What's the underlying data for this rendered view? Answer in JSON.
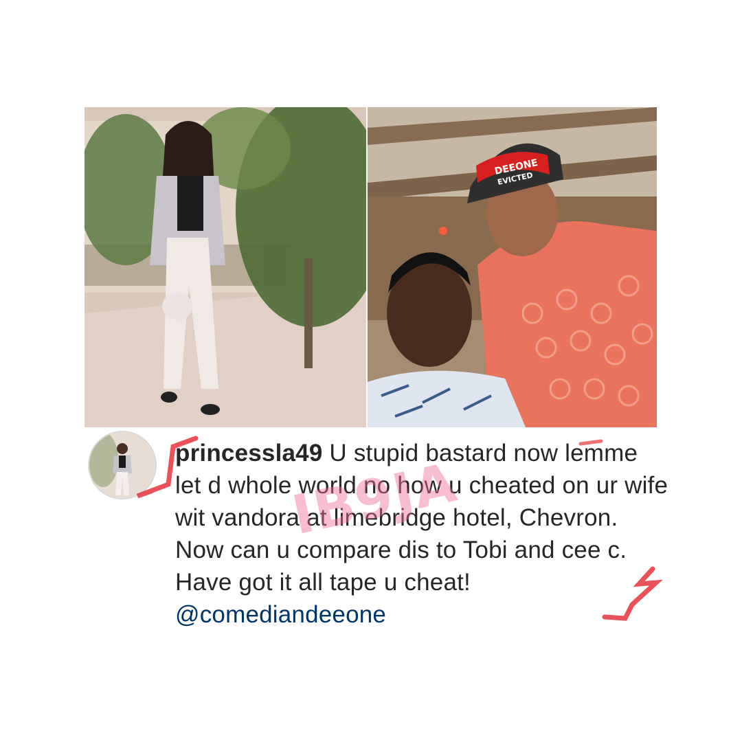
{
  "post": {
    "username": "princessla49",
    "comment": " U stupid bastard now lemme let d whole world no how u cheated on ur wife wit vandora at limebridge hotel, Chevron. Now can u compare dis to Tobi and cee c. Have got it all tape u cheat! ",
    "mention": "@comediandeeone"
  },
  "watermark": {
    "text": "IB9JA",
    "color": "#f06e96"
  },
  "cap_text": {
    "line1": "DEEONE",
    "line2": "EVICTED"
  },
  "icons": {
    "avatar": "profile-avatar",
    "left_photo": "woman-standing-photo",
    "right_photo": "couple-selfie-photo"
  },
  "colors": {
    "text": "#262626",
    "mention": "#003569",
    "marker_red": "#e8333b"
  }
}
